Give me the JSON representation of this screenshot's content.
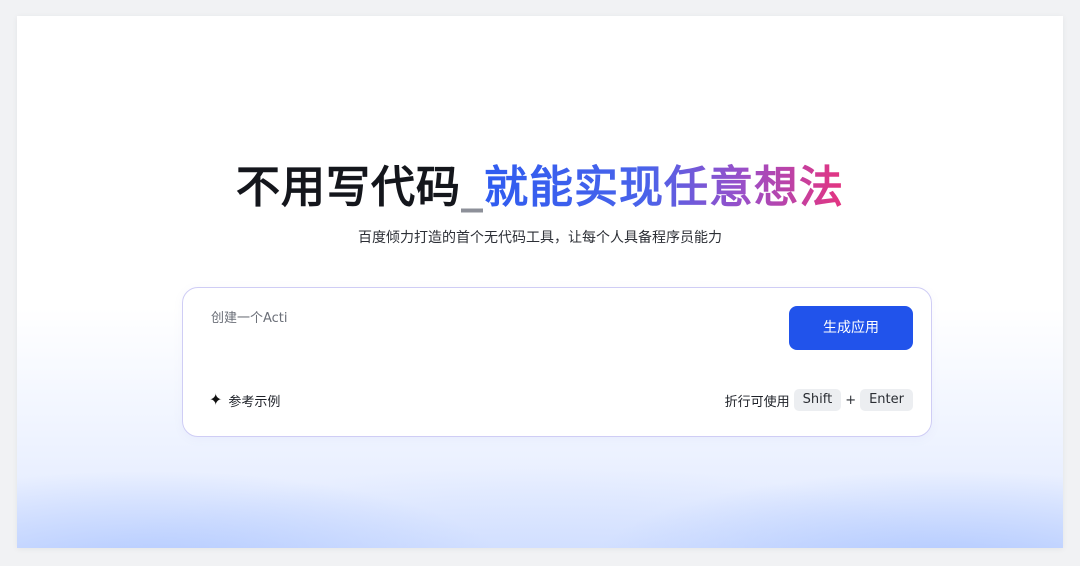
{
  "headline": {
    "part1": "不用写代码",
    "separator": "_",
    "part2": "就能实现任意想法"
  },
  "subtitle": "百度倾力打造的首个无代码工具，让每个人具备程序员能力",
  "prompt_box": {
    "input_value": "创建一个Acti",
    "generate_label": "生成应用",
    "examples_icon": "sparkle-icon",
    "examples_label": "参考示例",
    "newline_hint": "折行可使用",
    "key1": "Shift",
    "plus": "+",
    "key2": "Enter"
  },
  "colors": {
    "accent": "#2153eb",
    "gradient_start": "#2f5cf0",
    "gradient_end": "#e5347f",
    "card_border": "#cfcdf5"
  }
}
